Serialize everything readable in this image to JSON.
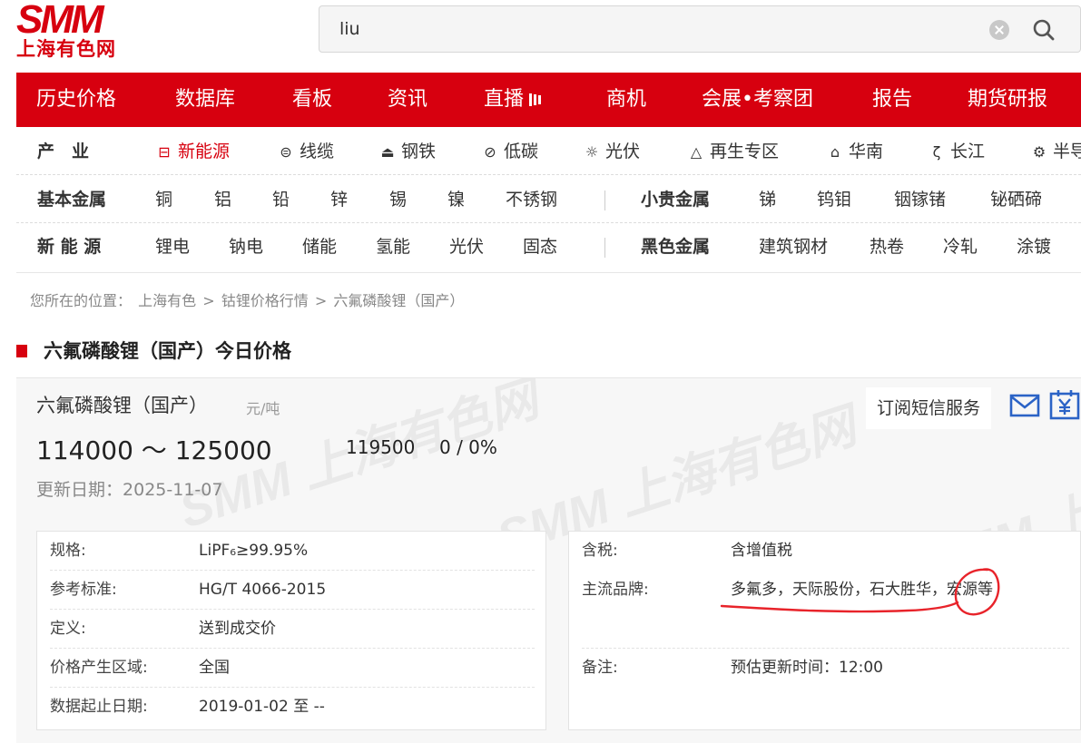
{
  "logo": {
    "brand": "SMM",
    "name": "上海有色网"
  },
  "search": {
    "value": "liu"
  },
  "main_nav": [
    "历史价格",
    "数据库",
    "看板",
    "资讯",
    "直播",
    "商机",
    "会展•考察团",
    "报告",
    "期货研报"
  ],
  "industry_row": {
    "label": "产　业",
    "items": [
      {
        "label": "新能源",
        "icon": "battery-icon"
      },
      {
        "label": "线缆",
        "icon": "cable-icon"
      },
      {
        "label": "钢铁",
        "icon": "steel-icon"
      },
      {
        "label": "低碳",
        "icon": "leaf-icon"
      },
      {
        "label": "光伏",
        "icon": "sun-icon"
      },
      {
        "label": "再生专区",
        "icon": "recycle-icon"
      },
      {
        "label": "华南",
        "icon": "map-icon"
      },
      {
        "label": "长江",
        "icon": "river-icon"
      },
      {
        "label": "半导",
        "icon": "chip-icon"
      }
    ]
  },
  "metal_row1": {
    "group1": "基本金属",
    "items1": [
      "铜",
      "铝",
      "铅",
      "锌",
      "锡",
      "镍",
      "不锈钢"
    ],
    "group2": "小贵金属",
    "items2": [
      "锑",
      "钨钼",
      "铟镓锗",
      "铋硒碲"
    ]
  },
  "metal_row2": {
    "group1": "新 能 源",
    "items1": [
      "锂电",
      "钠电",
      "储能",
      "氢能",
      "光伏",
      "固态"
    ],
    "group2": "黑色金属",
    "items2": [
      "建筑钢材",
      "热卷",
      "冷轧",
      "涂镀"
    ]
  },
  "breadcrumb": {
    "prefix": "您所在的位置：",
    "items": [
      "上海有色",
      "钴锂价格行情",
      "六氟磷酸锂（国产）"
    ],
    "sep": ">"
  },
  "section_title": "六氟磷酸锂（国产）今日价格",
  "price": {
    "name": "六氟磷酸锂（国产）",
    "unit": "元/吨",
    "range": "114000 ～ 125000",
    "avg": "119500",
    "change": "0 / 0%",
    "update_label": "更新日期：",
    "update_date": "2025-11-07",
    "subscribe": "订阅短信服务"
  },
  "specs_left": [
    {
      "k": "规格:",
      "v": "LiPF₆≥99.95%"
    },
    {
      "k": "参考标准:",
      "v": "HG/T 4066-2015"
    },
    {
      "k": "定义:",
      "v": "送到成交价"
    },
    {
      "k": "价格产生区域:",
      "v": "全国"
    },
    {
      "k": "数据起止日期:",
      "v": "2019-01-02 至 --"
    }
  ],
  "specs_right": [
    {
      "k": "含税:",
      "v": "含增值税"
    },
    {
      "k": "主流品牌:",
      "v": "多氟多，天际股份，石大胜华，宏源等"
    },
    {
      "k": "备注:",
      "v": "预估更新时间：12:00"
    }
  ],
  "watermark": "SMM 上海有色网",
  "colors": {
    "brand_red": "#d7000f",
    "annotation_red": "#e8232a"
  }
}
